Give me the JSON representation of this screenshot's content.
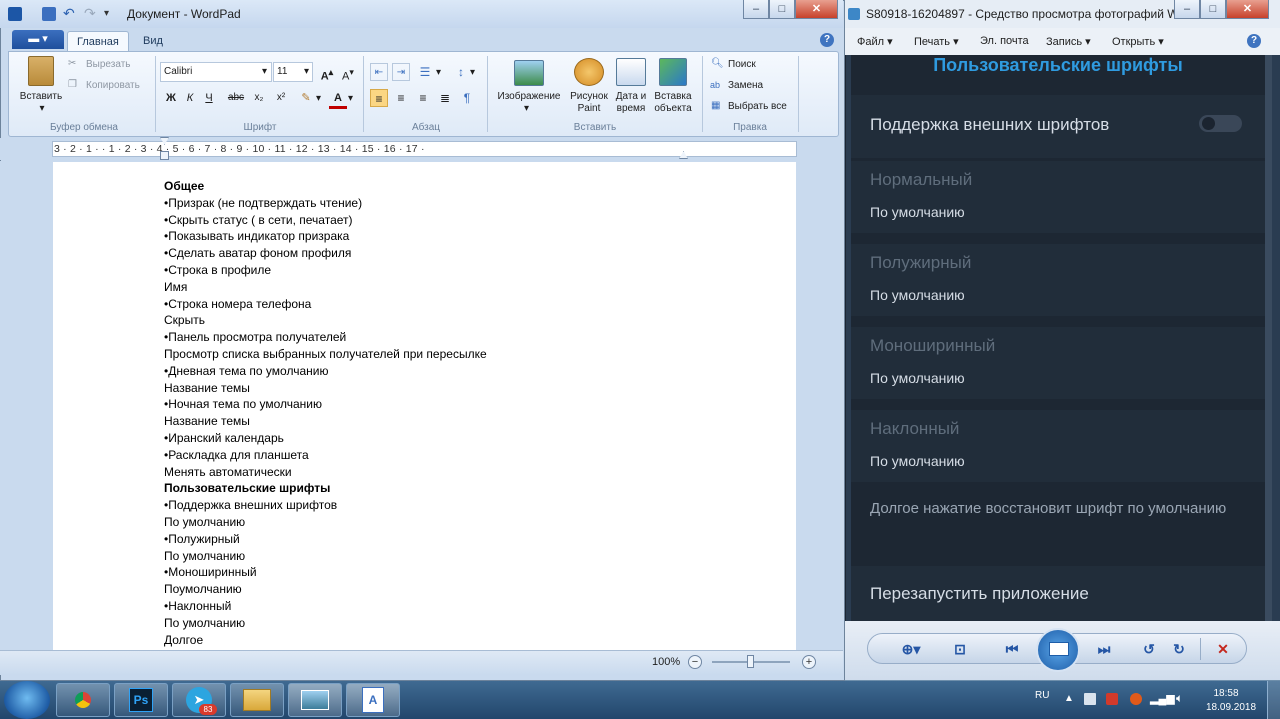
{
  "wordpad": {
    "title": "Документ - WordPad",
    "tabs": [
      "Главная",
      "Вид"
    ],
    "file_menu_label": "▾",
    "ribbon": {
      "clipboard": {
        "group": "Буфер обмена",
        "paste": "Вставить",
        "cut": "Вырезать",
        "copy": "Копировать"
      },
      "font": {
        "group": "Шрифт",
        "family": "Calibri",
        "size": "11",
        "bold": "Ж",
        "italic": "К",
        "underline": "Ч",
        "strike": "abc",
        "subscript": "x₂",
        "superscript": "x²"
      },
      "paragraph": {
        "group": "Абзац"
      },
      "insert": {
        "group": "Вставить",
        "image": "Изображение",
        "paint1": "Рисунок",
        "paint2": "Paint",
        "date1": "Дата и",
        "date2": "время",
        "object1": "Вставка",
        "object2": "объекта"
      },
      "edit": {
        "group": "Правка",
        "find": "Поиск",
        "replace": "Замена",
        "select_all": "Выбрать все"
      }
    },
    "ruler": "3 · 2 · 1 ·  · 1 · 2 · 3 · 4 · 5 · 6 · 7 · 8 · 9 · 10 · 11 · 12 · 13 · 14 · 15 · 16 · 17 ·",
    "document_lines": [
      {
        "text": "Общее",
        "bold": true
      },
      {
        "text": "•Призрак (не подтверждать чтение)"
      },
      {
        "text": "•Скрыть статус ( в сети, печатает)"
      },
      {
        "text": "•Показывать индикатор призрака"
      },
      {
        "text": "•Сделать аватар фоном профиля"
      },
      {
        "text": "•Строка в профиле"
      },
      {
        "text": "Имя"
      },
      {
        "text": "•Строка номера телефона"
      },
      {
        "text": "Скрыть"
      },
      {
        "text": "•Панель просмотра получателей"
      },
      {
        "text": "Просмотр списка выбранных получателей при пересылке"
      },
      {
        "text": "•Дневная тема по умолчанию"
      },
      {
        "text": "Название темы"
      },
      {
        "text": "•Ночная тема по умолчанию"
      },
      {
        "text": "Название темы"
      },
      {
        "text": "•Иранский календарь"
      },
      {
        "text": "•Раскладка для планшета"
      },
      {
        "text": "Менять автоматически"
      },
      {
        "text": "Пользовательские шрифты",
        "bold": true
      },
      {
        "text": "•Поддержка внешних шрифтов"
      },
      {
        "text": "По умолчанию"
      },
      {
        "text": "•Полужирный"
      },
      {
        "text": "По умолчанию"
      },
      {
        "text": "•Моноширинный"
      },
      {
        "text": "Поумолчанию"
      },
      {
        "text": "•Наклонный"
      },
      {
        "text": "По умолчанию"
      },
      {
        "text": "Долгое"
      }
    ],
    "zoom": "100%"
  },
  "photo_viewer": {
    "title": "S80918-16204897 - Средство просмотра фотографий Win...",
    "menu": [
      "Файл",
      "Печать",
      "Эл. почта",
      "Запись",
      "Открыть"
    ],
    "screen_header": "Пользовательские шрифты",
    "support_external": "Поддержка внешних шрифтов",
    "sections": [
      {
        "label": "Нормальный",
        "value": "По умолчанию"
      },
      {
        "label": "Полужирный",
        "value": "По умолчанию"
      },
      {
        "label": "Моноширинный",
        "value": "По умолчанию"
      },
      {
        "label": "Наклонный",
        "value": "По умолчанию"
      }
    ],
    "long_press_hint": "Долгое нажатие восстановит шрифт по умолчанию",
    "restart": "Перезапустить приложение",
    "accent_color": "#2f9be0"
  },
  "taskbar": {
    "lang": "RU",
    "time": "18:58",
    "date": "18.09.2018",
    "telegram_badge": "83",
    "ps_label": "Ps"
  }
}
